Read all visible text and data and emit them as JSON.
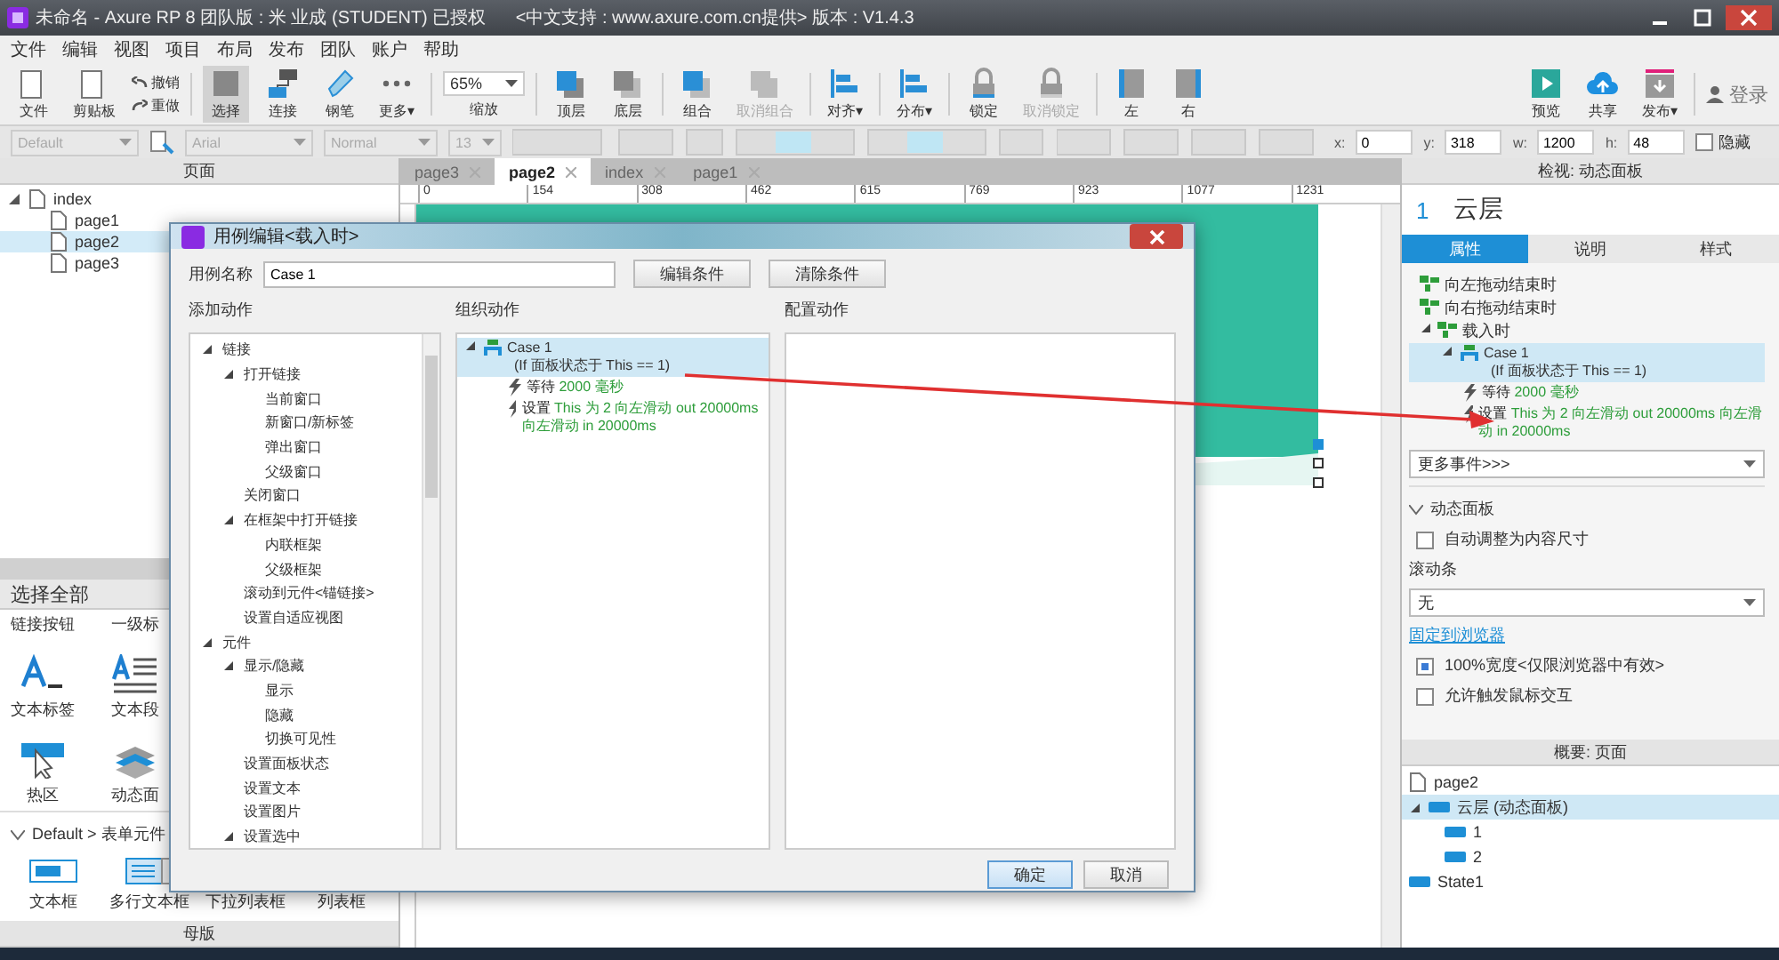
{
  "window": {
    "title": "未命名 - Axure RP 8 团队版 : 米 业成 (STUDENT) 已授权      <中文支持 : www.axure.com.cn提供> 版本 : V1.4.3"
  },
  "menu": [
    "文件",
    "编辑",
    "视图",
    "项目",
    "布局",
    "发布",
    "团队",
    "账户",
    "帮助"
  ],
  "toolbar": [
    {
      "kind": "file",
      "label": "文件",
      "pressed": false,
      "disabled": false
    },
    {
      "kind": "clipboard",
      "label": "剪贴板",
      "pressed": false,
      "disabled": false
    },
    {
      "kind": "history",
      "items": [
        "撤销",
        "重做"
      ]
    },
    {
      "kind": "separator"
    },
    {
      "kind": "select",
      "label": "选择",
      "pressed": true,
      "disabled": false
    },
    {
      "kind": "connect",
      "label": "连接",
      "pressed": false,
      "disabled": false
    },
    {
      "kind": "pen",
      "label": "钢笔",
      "pressed": false,
      "disabled": false
    },
    {
      "kind": "more",
      "label": "更多▾",
      "pressed": false,
      "disabled": false
    },
    {
      "kind": "separator"
    },
    {
      "kind": "zoom",
      "value": "65%",
      "label": "缩放"
    },
    {
      "kind": "separator"
    },
    {
      "kind": "front",
      "label": "顶层",
      "pressed": false,
      "disabled": false
    },
    {
      "kind": "back",
      "label": "底层",
      "pressed": false,
      "disabled": false
    },
    {
      "kind": "separator"
    },
    {
      "kind": "group",
      "label": "组合",
      "pressed": false,
      "disabled": false
    },
    {
      "kind": "ungroup",
      "label": "取消组合",
      "pressed": false,
      "disabled": true
    },
    {
      "kind": "separator"
    },
    {
      "kind": "align",
      "label": "对齐▾",
      "pressed": false,
      "disabled": false
    },
    {
      "kind": "separator"
    },
    {
      "kind": "distribute",
      "label": "分布▾",
      "pressed": false,
      "disabled": false
    },
    {
      "kind": "separator"
    },
    {
      "kind": "lock",
      "label": "锁定",
      "pressed": false,
      "disabled": false
    },
    {
      "kind": "unlock",
      "label": "取消锁定",
      "pressed": false,
      "disabled": true
    },
    {
      "kind": "separator"
    },
    {
      "kind": "left",
      "label": "左",
      "pressed": false,
      "disabled": false
    },
    {
      "kind": "right",
      "label": "右",
      "pressed": false,
      "disabled": false
    },
    {
      "kind": "spacer"
    },
    {
      "kind": "preview",
      "label": "预览",
      "pressed": false,
      "disabled": false
    },
    {
      "kind": "share",
      "label": "共享",
      "pressed": false,
      "disabled": false
    },
    {
      "kind": "publish",
      "label": "发布▾",
      "pressed": false,
      "disabled": false
    },
    {
      "kind": "separator"
    },
    {
      "kind": "login",
      "label": "登录"
    }
  ],
  "format_bar": {
    "style": "Default",
    "font": "Arial",
    "weight": "Normal",
    "size": "13",
    "fields": [
      {
        "label": "x:",
        "value": "0"
      },
      {
        "label": "y:",
        "value": "318"
      },
      {
        "label": "w:",
        "value": "1200"
      },
      {
        "label": "h:",
        "value": "48"
      }
    ],
    "hidden": {
      "label": "隐藏",
      "checked": false
    }
  },
  "pages_panel": {
    "title": "页面",
    "pages": [
      {
        "label": "index",
        "selected": false,
        "expanded": true,
        "children": [
          {
            "label": "page1",
            "selected": false
          },
          {
            "label": "page2",
            "selected": true
          },
          {
            "label": "page3",
            "selected": false
          }
        ]
      }
    ]
  },
  "library": {
    "filter": "选择全部",
    "rows": [
      [
        {
          "kind": "cut",
          "label": "链接按钮"
        },
        {
          "kind": "cut",
          "label": "一级标"
        }
      ],
      [
        {
          "kind": "text-label",
          "label": "文本标签"
        },
        {
          "kind": "paragraph",
          "label": "文本段"
        }
      ],
      [
        {
          "kind": "hotspot",
          "label": "热区"
        },
        {
          "kind": "dynamic-panel",
          "label": "动态面"
        }
      ]
    ],
    "section": "Default > 表单元件",
    "form_items": [
      {
        "kind": "text-field",
        "label": "文本框"
      },
      {
        "kind": "text-area",
        "label": "多行文本框"
      },
      {
        "label": "下拉列表框"
      },
      {
        "label": "列表框"
      }
    ]
  },
  "masters_panel": {
    "title": "母版"
  },
  "canvas": {
    "tabs": [
      {
        "label": "page3",
        "selected": false
      },
      {
        "label": "page2",
        "selected": true
      },
      {
        "label": "index",
        "selected": false
      },
      {
        "label": "page1",
        "selected": false
      }
    ],
    "ruler": [
      "0",
      "154",
      "308",
      "462",
      "615",
      "769",
      "923",
      "1077",
      "1231"
    ]
  },
  "inspector": {
    "title": "检视: 动态面板",
    "number": "1",
    "name": "云层",
    "tabs": [
      {
        "label": "属性",
        "selected": true
      },
      {
        "label": "说明",
        "selected": false
      },
      {
        "label": "样式",
        "selected": false
      }
    ],
    "events": [
      {
        "kind": "event",
        "label": "向左拖动结束时",
        "selected": false
      },
      {
        "kind": "event",
        "label": "向右拖动结束时",
        "selected": false
      },
      {
        "kind": "event",
        "label": "载入时",
        "selected": false,
        "expanded": true,
        "children": [
          {
            "kind": "case",
            "label": "Case 1",
            "condition": "(If 面板状态于 This == 1)",
            "selected": true,
            "expanded": true,
            "children": [
              {
                "kind": "action",
                "verb": "等待",
                "detail": "2000 毫秒",
                "selected": false
              },
              {
                "kind": "action",
                "verb": "设置",
                "detail": "This 为 2 向左滑动 out 20000ms 向左滑动 in 20000ms",
                "selected": false
              }
            ]
          }
        ]
      }
    ],
    "more_events": "更多事件>>>",
    "section": {
      "label": "动态面板",
      "expanded": true
    },
    "auto_fit": {
      "label": "自动调整为内容尺寸",
      "checked": false
    },
    "scrollbar_label": "滚动条",
    "scrollbar_value": "无",
    "pin_link": "固定到浏览器",
    "full_width": {
      "label": "100%宽度<仅限浏览器中有效>",
      "checked": true
    },
    "mouse_interaction": {
      "label": "允许触发鼠标交互",
      "checked": false
    }
  },
  "outline": {
    "title": "概要: 页面",
    "page": "page2",
    "items": [
      {
        "label": "云层 (动态面板)",
        "selected": true,
        "expanded": true,
        "children": [
          {
            "label": "1",
            "selected": false
          },
          {
            "label": "2",
            "selected": false
          }
        ]
      },
      {
        "label": "State1",
        "selected": false
      }
    ]
  },
  "dialog": {
    "title": "用例编辑<载入时>",
    "case_label": "用例名称",
    "case_name": "Case 1",
    "buttons": [
      "编辑条件",
      "清除条件"
    ],
    "add_title": "添加动作",
    "organize_title": "组织动作",
    "config_title": "配置动作",
    "add_actions": [
      {
        "label": "链接",
        "expanded": true,
        "children": [
          {
            "label": "打开链接",
            "expanded": true,
            "children": [
              {
                "label": "当前窗口"
              },
              {
                "label": "新窗口/新标签"
              },
              {
                "label": "弹出窗口"
              },
              {
                "label": "父级窗口"
              }
            ]
          },
          {
            "label": "关闭窗口"
          },
          {
            "label": "在框架中打开链接",
            "expanded": true,
            "children": [
              {
                "label": "内联框架"
              },
              {
                "label": "父级框架"
              }
            ]
          },
          {
            "label": "滚动到元件<锚链接>"
          },
          {
            "label": "设置自适应视图"
          }
        ]
      },
      {
        "label": "元件",
        "expanded": true,
        "children": [
          {
            "label": "显示/隐藏",
            "expanded": true,
            "children": [
              {
                "label": "显示"
              },
              {
                "label": "隐藏"
              },
              {
                "label": "切换可见性"
              }
            ]
          },
          {
            "label": "设置面板状态"
          },
          {
            "label": "设置文本"
          },
          {
            "label": "设置图片"
          },
          {
            "label": "设置选中",
            "expanded": true
          }
        ]
      }
    ],
    "organize": [
      {
        "kind": "case",
        "label": "Case 1",
        "condition": "(If 面板状态于 This == 1)",
        "selected": true,
        "expanded": true,
        "children": [
          {
            "kind": "action",
            "verb": "等待",
            "detail": "2000 毫秒",
            "selected": false
          },
          {
            "kind": "action",
            "verb": "设置",
            "detail": "This 为 2 向左滑动 out 20000ms 向左滑动 in 20000ms",
            "selected": false
          }
        ]
      }
    ],
    "ok": "确定",
    "cancel": "取消"
  }
}
